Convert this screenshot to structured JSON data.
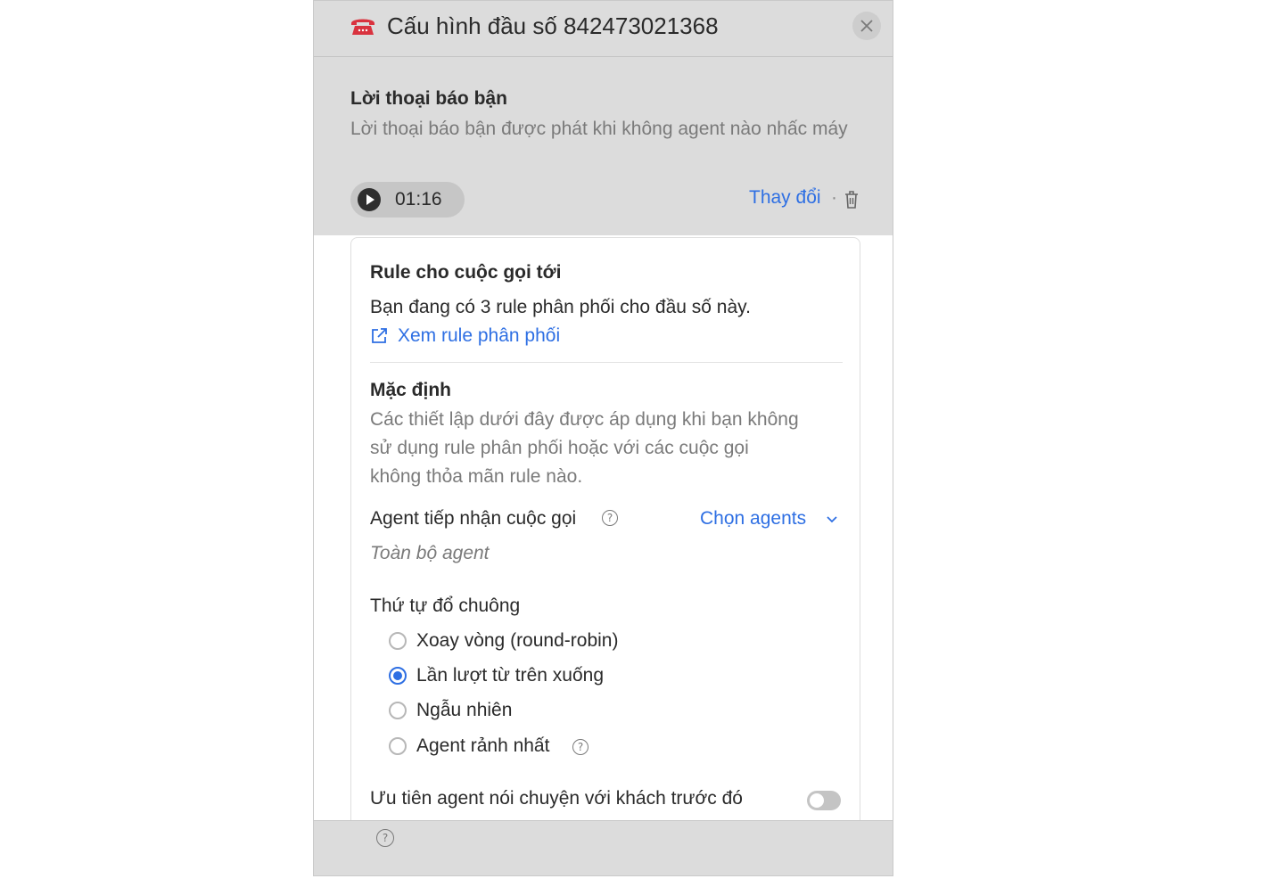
{
  "header": {
    "title": "Cấu hình đầu số 842473021368",
    "icon": "phone-icon",
    "close_icon": "close-icon"
  },
  "busy": {
    "title": "Lời thoại báo bận",
    "description": "Lời thoại báo bận được phát khi không agent nào nhấc máy",
    "player_time": "01:16",
    "change_label": "Thay đổi",
    "separator": "·"
  },
  "rule": {
    "title": "Rule cho cuộc gọi tới",
    "description": "Bạn đang có 3 rule phân phối cho đầu số này.",
    "link_label": "Xem rule phân phối"
  },
  "default": {
    "title": "Mặc định",
    "description_lines": [
      "Các thiết lập dưới đây được áp dụng khi bạn không",
      "sử dụng rule phân phối hoặc với các cuộc gọi",
      "không thỏa mãn rule nào."
    ],
    "agent_label": "Agent tiếp nhận cuộc gọi",
    "choose_agents": "Chọn agents",
    "agent_value": "Toàn bộ agent",
    "ring_order_label": "Thứ tự đổ chuông",
    "options": [
      {
        "label": "Xoay vòng (round-robin)",
        "checked": false
      },
      {
        "label": "Lần lượt từ trên xuống",
        "checked": true
      },
      {
        "label": "Ngẫu nhiên",
        "checked": false
      },
      {
        "label": "Agent rảnh nhất",
        "checked": false
      }
    ],
    "priority_label": "Ưu tiên agent nói chuyện với khách trước đó",
    "priority_enabled": false
  },
  "colors": {
    "accent": "#2e6fe3",
    "phone_icon": "#d9333f",
    "overlay": "#dcdcdc"
  }
}
